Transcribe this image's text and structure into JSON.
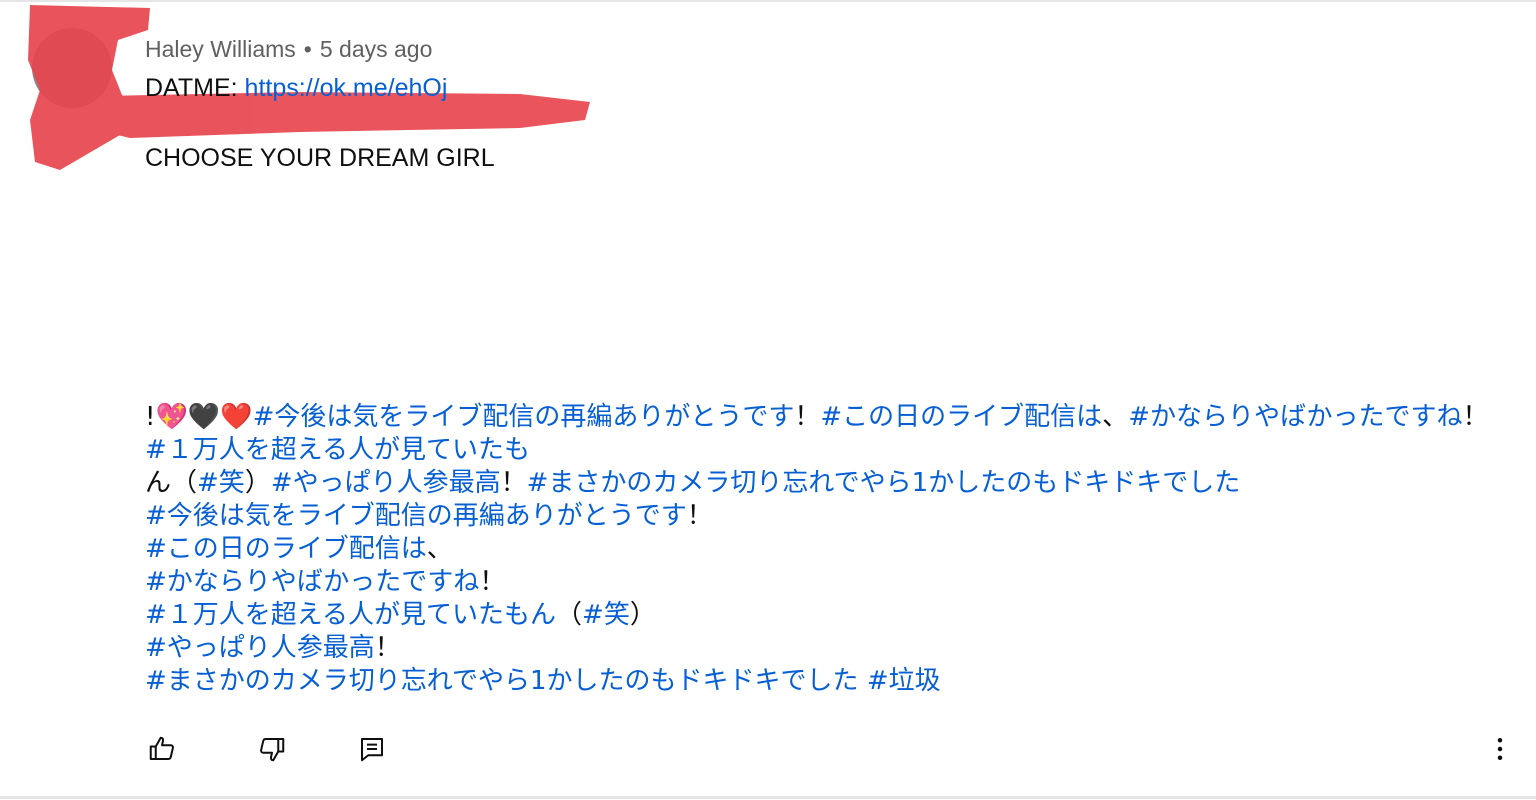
{
  "comment": {
    "author": "Haley Williams",
    "separator": "•",
    "time": "5 days ago",
    "prefix": "DATME: ",
    "link": "https://ok.me/ehOj",
    "headline": "CHOOSE YOUR DREAM GIRL",
    "body": {
      "row1_start": "!",
      "row1_emoji": "💖🖤❤️",
      "row1_tag1": "#今後は気をライブ配信の再編ありがとうです",
      "row1_sep1": "！",
      "row1_tag2": "#この日のライブ配信は",
      "row1_sep2": "、",
      "row1_tag3": "#かならりやばかったですね",
      "row1_sep3": "！",
      "row1_tag4": "#１万人を超える人が見ていたも",
      "row2_text": "ん（",
      "row2_tag1": "#笑",
      "row2_sep1": "）",
      "row2_tag2": "#やっぱり人参最高",
      "row2_sep2": "！",
      "row2_tag3": "#まさかのカメラ切り忘れでやら1かしたのもドキドキでした",
      "row3_tag": "#今後は気をライブ配信の再編ありがとうです",
      "row3_end": "！",
      "row4_tag": "#この日のライブ配信は",
      "row4_end": "、",
      "row5_tag": "#かならりやばかったですね",
      "row5_end": "！",
      "row6_tag": "#１万人を超える人が見ていたもん",
      "row6_mid": "（",
      "row6_tag2": "#笑",
      "row6_end": "）",
      "row7_tag": "#やっぱり人参最高",
      "row7_end": "！",
      "row8_tag": "#まさかのカメラ切り忘れでやら1かしたのもドキドキでした",
      "row8_tag2": "#垃圾"
    }
  },
  "actions": {
    "like_icon": "thumb-up-icon",
    "dislike_icon": "thumb-down-icon",
    "reply_icon": "comment-icon",
    "more_icon": "more-vert-icon"
  },
  "colors": {
    "link": "#065fd4",
    "meta": "#606060",
    "text": "#0f0f0f",
    "redaction": "#e8464f"
  }
}
